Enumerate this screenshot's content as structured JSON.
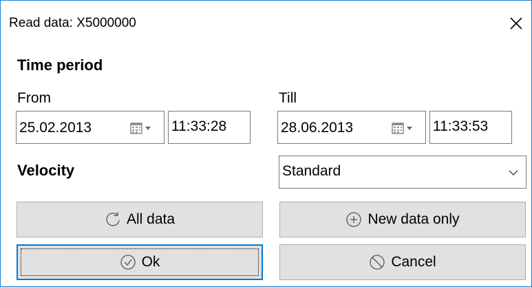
{
  "window": {
    "title": "Read data: X5000000"
  },
  "time_period": {
    "heading": "Time period",
    "from": {
      "label": "From",
      "date": "25.02.2013",
      "time": "11:33:28"
    },
    "till": {
      "label": "Till",
      "date": "28.06.2013",
      "time": "11:33:53"
    }
  },
  "velocity": {
    "label": "Velocity",
    "selected": "Standard"
  },
  "buttons": {
    "all_data": "All data",
    "new_data_only": "New data only",
    "ok": "Ok",
    "cancel": "Cancel"
  },
  "icons": {
    "close": "close-icon",
    "calendar": "calendar-icon",
    "dropdown": "chevron-down-icon",
    "refresh": "refresh-icon",
    "add": "plus-circle-icon",
    "check": "check-circle-icon",
    "cancel": "cancel-circle-icon"
  },
  "colors": {
    "window_border": "#1883d7",
    "button_face": "#e1e1e1",
    "default_button_border": "#0078d7",
    "field_border": "#7a7a7a"
  }
}
